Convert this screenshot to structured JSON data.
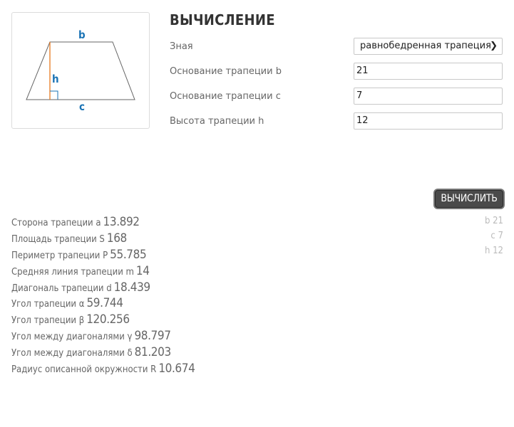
{
  "figure": {
    "label_b": "b",
    "label_h": "h",
    "label_c": "c",
    "line_color": "#666666",
    "height_color": "#e8781e",
    "label_color": "#1a73b5"
  },
  "header": {
    "title": "ВЫЧИСЛЕНИЕ"
  },
  "form": {
    "known": {
      "label": "Зная",
      "value": "равнобедренная трапеция"
    },
    "base_b": {
      "label": "Основание трапеции b",
      "value": "21"
    },
    "base_c": {
      "label": "Основание трапеции c",
      "value": "7"
    },
    "height_h": {
      "label": "Высота трапеции h",
      "value": "12"
    }
  },
  "calculate_button": "ВЫЧИСЛИТЬ",
  "results": [
    {
      "label": "Сторона трапеции a",
      "value": "13.892"
    },
    {
      "label": "Площадь трапеции S",
      "value": "168"
    },
    {
      "label": "Периметр трапеции P",
      "value": "55.785"
    },
    {
      "label": "Средняя линия трапеции m",
      "value": "14"
    },
    {
      "label": "Диагональ трапеции d",
      "value": "18.439"
    },
    {
      "label": "Угол трапеции α",
      "value": "59.744"
    },
    {
      "label": "Угол трапеции β",
      "value": "120.256"
    },
    {
      "label": "Угол между диагоналями γ",
      "value": "98.797"
    },
    {
      "label": "Угол между диагоналями δ",
      "value": "81.203"
    },
    {
      "label": "Радиус описанной окружности R",
      "value": "10.674"
    }
  ],
  "inputs_echo": [
    "b 21",
    "c 7",
    "h 12"
  ]
}
